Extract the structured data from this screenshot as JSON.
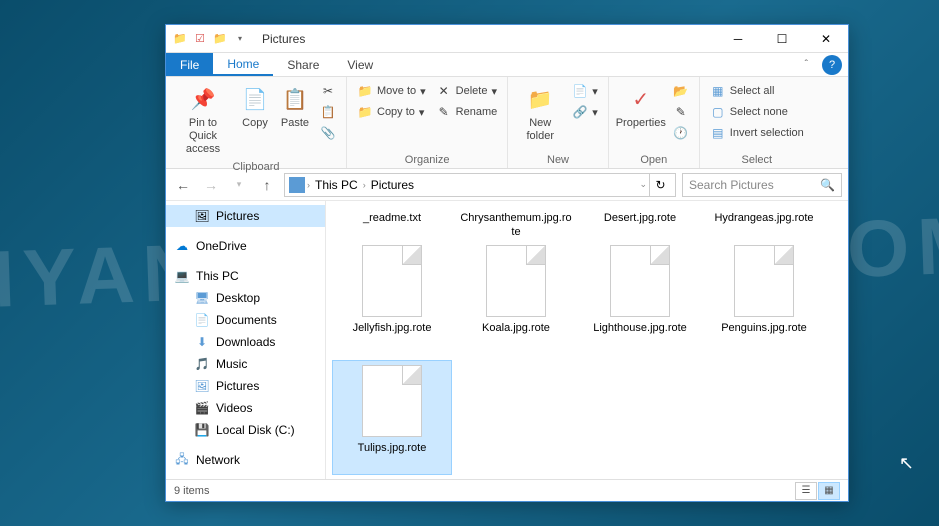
{
  "watermark": "MYANTISPYWARE.COM",
  "title": "Pictures",
  "tabs": {
    "file": "File",
    "home": "Home",
    "share": "Share",
    "view": "View"
  },
  "ribbon": {
    "clipboard": {
      "label": "Clipboard",
      "pin": "Pin to Quick access",
      "copy": "Copy",
      "paste": "Paste"
    },
    "organize": {
      "label": "Organize",
      "moveto": "Move to",
      "copyto": "Copy to",
      "delete": "Delete",
      "rename": "Rename"
    },
    "new": {
      "label": "New",
      "newfolder": "New folder"
    },
    "open": {
      "label": "Open",
      "properties": "Properties"
    },
    "select": {
      "label": "Select",
      "all": "Select all",
      "none": "Select none",
      "invert": "Invert selection"
    }
  },
  "breadcrumb": {
    "thispc": "This PC",
    "pictures": "Pictures"
  },
  "search_placeholder": "Search Pictures",
  "sidebar": {
    "pictures": "Pictures",
    "onedrive": "OneDrive",
    "thispc": "This PC",
    "desktop": "Desktop",
    "documents": "Documents",
    "downloads": "Downloads",
    "music": "Music",
    "pictures2": "Pictures",
    "videos": "Videos",
    "localdisk": "Local Disk (C:)",
    "network": "Network"
  },
  "files": [
    {
      "name": "_readme.txt",
      "partial": true
    },
    {
      "name": "Chrysanthemum.jpg.rote",
      "partial": true
    },
    {
      "name": "Desert.jpg.rote",
      "partial": true
    },
    {
      "name": "Hydrangeas.jpg.rote",
      "partial": true
    },
    {
      "name": "Jellyfish.jpg.rote",
      "partial": false
    },
    {
      "name": "Koala.jpg.rote",
      "partial": false
    },
    {
      "name": "Lighthouse.jpg.rote",
      "partial": false
    },
    {
      "name": "Penguins.jpg.rote",
      "partial": false
    },
    {
      "name": "Tulips.jpg.rote",
      "partial": false,
      "selected": true
    }
  ],
  "status": "9 items"
}
